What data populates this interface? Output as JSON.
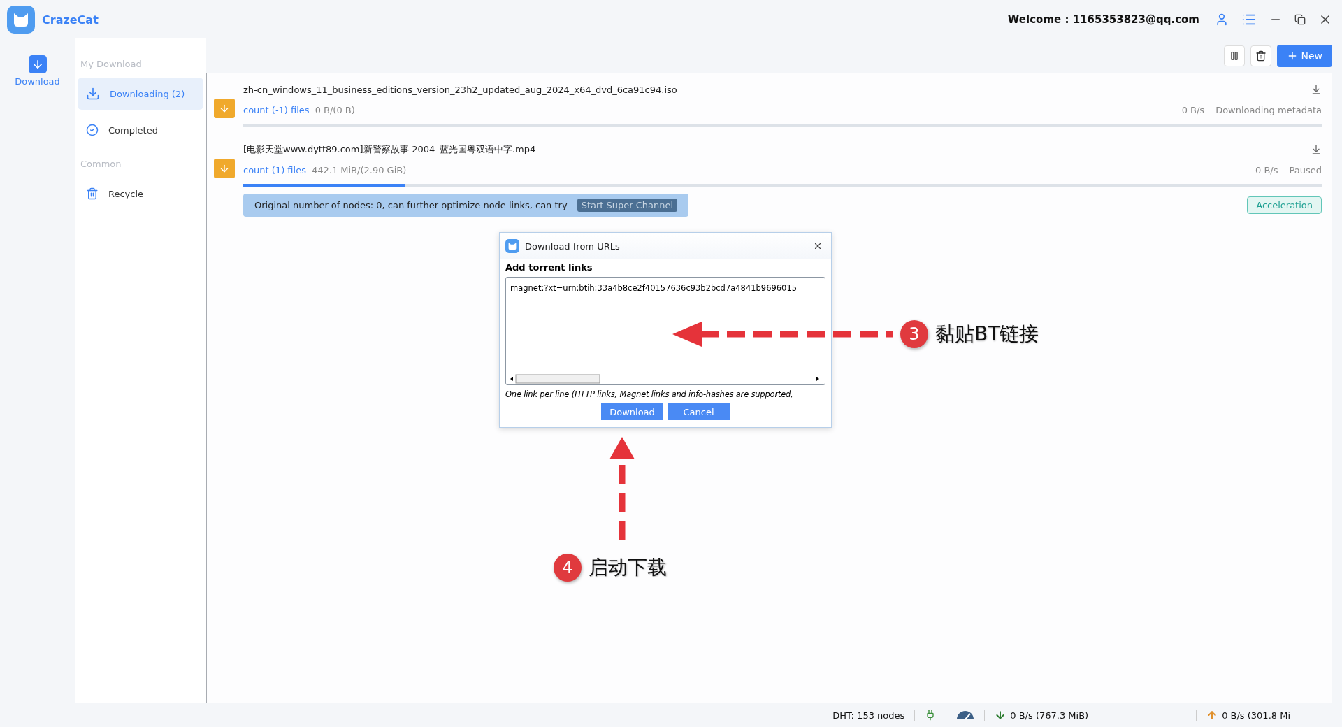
{
  "app": {
    "name": "CrazeCat"
  },
  "header": {
    "welcome": "Welcome : 1165353823@qq.com"
  },
  "rail": [
    {
      "label": "Download",
      "selected": true
    }
  ],
  "sidebar": {
    "sections": [
      {
        "heading": "My Download",
        "items": [
          {
            "label": "Downloading (2)",
            "kind": "download",
            "selected": true
          },
          {
            "label": "Completed",
            "kind": "check",
            "selected": false
          }
        ]
      },
      {
        "heading": "Common",
        "items": [
          {
            "label": "Recycle",
            "kind": "trash",
            "selected": false
          }
        ]
      }
    ]
  },
  "toolbar": {
    "new_button": "New"
  },
  "downloads": [
    {
      "name": "zh-cn_windows_11_business_editions_version_23h2_updated_aug_2024_x64_dvd_6ca91c94.iso",
      "count": "count (-1) files",
      "size": "0 B/(0 B)",
      "speed": "0 B/s",
      "status": "Downloading metadata",
      "level": 0
    },
    {
      "name": "[电影天堂www.dytt89.com]新警察故事-2004_蓝光国粤双语中字.mp4",
      "count": "count (1) files",
      "size": "442.1 MiB/(2.90 GiB)",
      "speed": "0 B/s",
      "status": "Paused",
      "level": 0.15
    }
  ],
  "banner": {
    "text": "Original number of nodes: 0, can further optimize node links, can try",
    "button": "Start Super Channel"
  },
  "acceleration_button": "Acceleration",
  "dialog": {
    "title": "Download from URLs",
    "label": "Add torrent links",
    "value": "magnet:?xt=urn:btih:33a4b8ce2f40157636c93b2bcd7a4841b9696015",
    "hint": "One link per line (HTTP links, Magnet links and info-hashes are supported,",
    "buttons": [
      "Download",
      "Cancel"
    ]
  },
  "annotations": [
    {
      "number": "3",
      "text": "黏贴BT链接",
      "kind": "left"
    },
    {
      "number": "4",
      "text": "启动下载",
      "kind": "up"
    }
  ],
  "status_bar": {
    "dht": "DHT: 153 nodes",
    "download": "0 B/s (767.3 MiB)",
    "upload": "0 B/s (301.8 Mi"
  }
}
